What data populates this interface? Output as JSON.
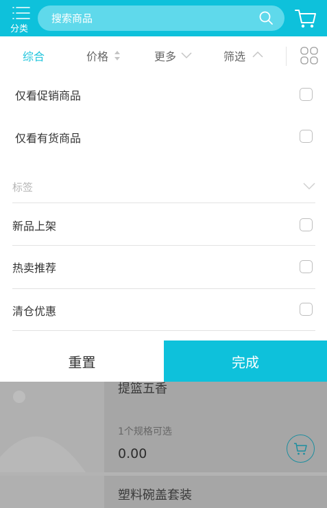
{
  "header": {
    "category_label": "分类",
    "search_placeholder": "搜索商品"
  },
  "sort_bar": {
    "items": [
      {
        "label": "综合",
        "active": true
      },
      {
        "label": "价格"
      },
      {
        "label": "更多"
      },
      {
        "label": "筛选"
      }
    ]
  },
  "filters": {
    "options": [
      {
        "label": "仅看促销商品",
        "checked": false
      },
      {
        "label": "仅看有货商品",
        "checked": false
      }
    ],
    "tag_section": {
      "title": "标签",
      "tags": [
        {
          "label": "新品上架",
          "checked": false
        },
        {
          "label": "热卖推荐",
          "checked": false
        },
        {
          "label": "清仓优惠",
          "checked": false
        }
      ]
    }
  },
  "actions": {
    "reset_label": "重置",
    "done_label": "完成"
  },
  "products": [
    {
      "name": "提篮五香",
      "spec": "1个规格可选",
      "price": "0.00"
    },
    {
      "name": "塑料碗盖套装"
    }
  ],
  "colors": {
    "accent": "#0ec1db",
    "search_bg": "#5fd9eb",
    "overlay": "#a6a6a6"
  }
}
